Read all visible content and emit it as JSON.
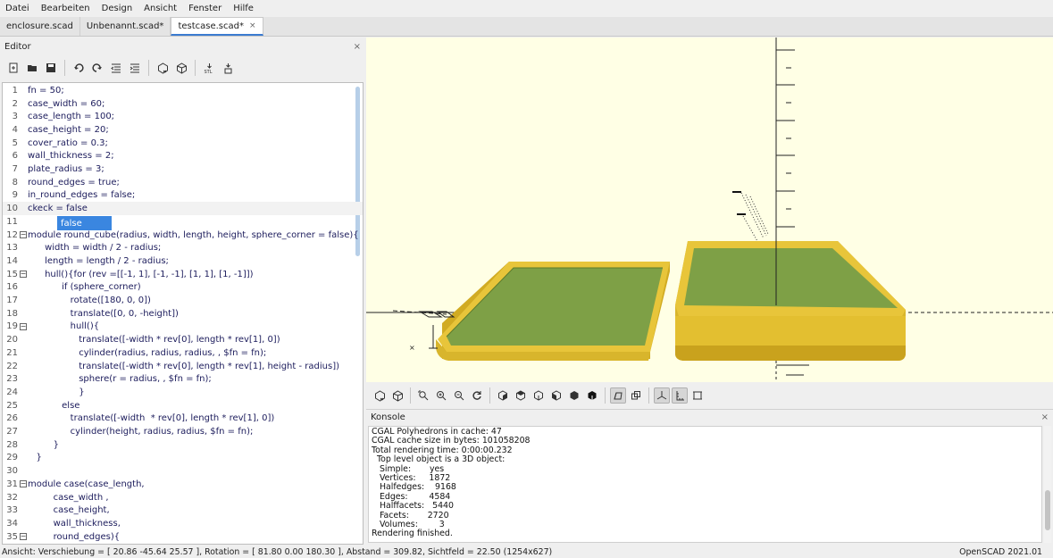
{
  "menubar": {
    "items": [
      "Datei",
      "Bearbeiten",
      "Design",
      "Ansicht",
      "Fenster",
      "Hilfe"
    ]
  },
  "tabs": [
    {
      "label": "enclosure.scad",
      "active": false
    },
    {
      "label": "Unbenannt.scad*",
      "active": false
    },
    {
      "label": "testcase.scad*",
      "active": true,
      "close": "×"
    }
  ],
  "editor": {
    "title": "Editor",
    "close": "×",
    "toolbar_icons": [
      "new-file-icon",
      "open-file-icon",
      "save-icon",
      "undo-icon",
      "redo-icon",
      "unindent-icon",
      "indent-icon",
      "preview-icon",
      "render-icon",
      "export-stl-icon",
      "send-to-print-icon"
    ],
    "autocomplete_suggestion": "false",
    "lines": [
      {
        "n": "1",
        "text": "fn = 50;"
      },
      {
        "n": "2",
        "text": "case_width = 60;"
      },
      {
        "n": "3",
        "text": "case_length = 100;"
      },
      {
        "n": "4",
        "text": "case_height = 20;"
      },
      {
        "n": "5",
        "text": "cover_ratio = 0.3;"
      },
      {
        "n": "6",
        "text": "wall_thickness = 2;"
      },
      {
        "n": "7",
        "text": "plate_radius = 3;"
      },
      {
        "n": "8",
        "text": "round_edges = true;"
      },
      {
        "n": "9",
        "text": "in_round_edges = false;"
      },
      {
        "n": "10",
        "text": "ckeck = false"
      },
      {
        "n": "11",
        "text": ""
      },
      {
        "n": "12",
        "text": "module round_cube(radius, width, length, height, sphere_corner = false){",
        "fold": "⊟"
      },
      {
        "n": "13",
        "text": "      width = width / 2 - radius;"
      },
      {
        "n": "14",
        "text": "      length = length / 2 - radius;"
      },
      {
        "n": "15",
        "text": "      hull(){for (rev =[[-1, 1], [-1, -1], [1, 1], [1, -1]])",
        "fold": "⊟"
      },
      {
        "n": "16",
        "text": "            if (sphere_corner)"
      },
      {
        "n": "17",
        "text": "               rotate([180, 0, 0])"
      },
      {
        "n": "18",
        "text": "               translate([0, 0, -height])"
      },
      {
        "n": "19",
        "text": "               hull(){",
        "fold": "⊟"
      },
      {
        "n": "20",
        "text": "                  translate([-width * rev[0], length * rev[1], 0])"
      },
      {
        "n": "21",
        "text": "                  cylinder(radius, radius, radius, , $fn = fn);"
      },
      {
        "n": "22",
        "text": "                  translate([-width * rev[0], length * rev[1], height - radius])"
      },
      {
        "n": "23",
        "text": "                  sphere(r = radius, , $fn = fn);"
      },
      {
        "n": "24",
        "text": "                  }"
      },
      {
        "n": "25",
        "text": "            else"
      },
      {
        "n": "26",
        "text": "               translate([-width  * rev[0], length * rev[1], 0])"
      },
      {
        "n": "27",
        "text": "               cylinder(height, radius, radius, $fn = fn);"
      },
      {
        "n": "28",
        "text": "         }"
      },
      {
        "n": "29",
        "text": "   }"
      },
      {
        "n": "30",
        "text": ""
      },
      {
        "n": "31",
        "text": "module case(case_length,",
        "fold": "⊟"
      },
      {
        "n": "32",
        "text": "         case_width ,"
      },
      {
        "n": "33",
        "text": "         case_height,"
      },
      {
        "n": "34",
        "text": "         wall_thickness,"
      },
      {
        "n": "35",
        "text": "         round_edges){",
        "fold": "⊟"
      }
    ]
  },
  "viewport": {
    "background": "#ffffe5",
    "model_top_color": "#7ea046",
    "model_side_color": "#e8c53a",
    "toolbar_icons": [
      "preview-icon",
      "render-icon",
      "zoom-all-icon",
      "zoom-in-icon",
      "zoom-out-icon",
      "reset-view-icon",
      "view-right-icon",
      "view-top-icon",
      "view-bottom-icon",
      "view-left-icon",
      "view-front-icon",
      "view-back-icon",
      "perspective-icon",
      "orthogonal-icon",
      "show-axes-icon",
      "show-scale-icon",
      "show-edges-icon"
    ]
  },
  "console": {
    "title": "Konsole",
    "close": "×",
    "lines": [
      "CGAL Polyhedrons in cache: 47",
      "CGAL cache size in bytes: 101058208",
      "Total rendering time: 0:00:00.232",
      "  Top level object is a 3D object:",
      "   Simple:       yes",
      "   Vertices:     1872",
      "   Halfedges:    9168",
      "   Edges:        4584",
      "   Halffacets:   5440",
      "   Facets:       2720",
      "   Volumes:        3",
      "Rendering finished."
    ]
  },
  "statusbar": {
    "left": "Ansicht: Verschiebung = [ 20.86 -45.64 25.57 ], Rotation = [ 81.80 0.00 180.30 ], Abstand = 309.82, Sichtfeld = 22.50 (1254x627)",
    "right": "OpenSCAD 2021.01"
  }
}
